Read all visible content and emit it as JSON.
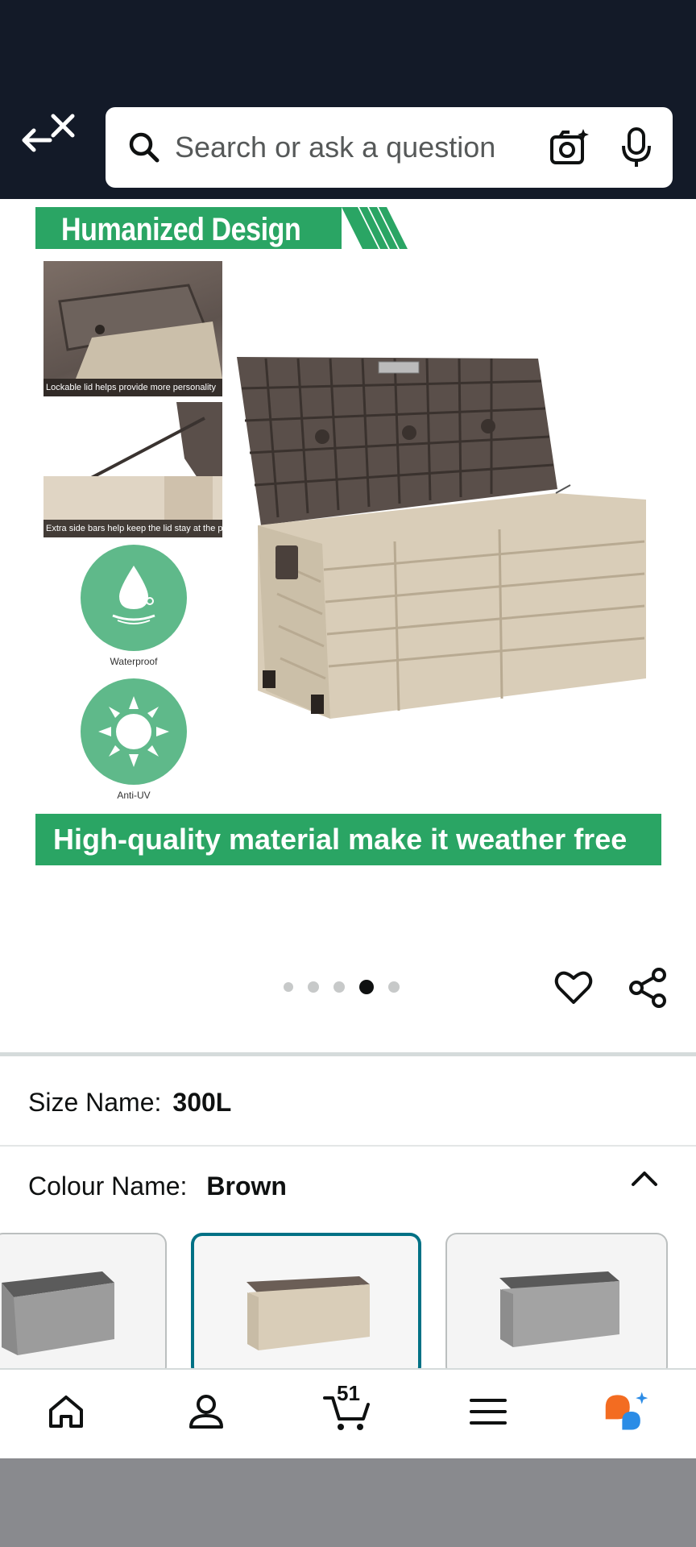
{
  "header": {
    "search_placeholder": "Search or ask a question",
    "background_color": "#131a28",
    "icons": [
      "back-close-icon",
      "search-icon",
      "camera-sparkle-icon",
      "microphone-icon"
    ]
  },
  "product_image": {
    "top_banner": "Humanized Design",
    "thumb1_caption": "Lockable lid helps provide more personality",
    "thumb2_caption": "Extra side bars help keep the lid stay at the position",
    "feature1_label": "Waterproof",
    "feature2_label": "Anti-UV",
    "bottom_banner": "High-quality material make it weather free",
    "accent_color": "#2aa564"
  },
  "carousel": {
    "dot_count": 5,
    "active_index": 3
  },
  "variations": {
    "size_label": "Size Name:",
    "size_value": "300L",
    "colour_label": "Colour Name:",
    "colour_value": "Brown",
    "selected_border_color": "#007185"
  },
  "bottom_nav": {
    "cart_count": "51",
    "items": [
      "home-icon",
      "account-icon",
      "cart-icon",
      "menu-icon",
      "rufus-ai-icon"
    ]
  }
}
